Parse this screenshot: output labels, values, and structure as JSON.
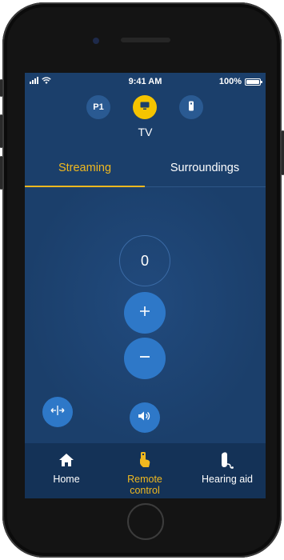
{
  "status_bar": {
    "time": "9:41 AM",
    "battery_percent": "100%"
  },
  "programs": [
    {
      "label": "P1",
      "active": false
    },
    {
      "icon": "tv-icon",
      "active": true
    },
    {
      "icon": "remote-icon",
      "active": false
    }
  ],
  "device_label": "TV",
  "tabs": [
    {
      "label": "Streaming",
      "active": true
    },
    {
      "label": "Surroundings",
      "active": false
    }
  ],
  "volume": {
    "level": "0"
  },
  "bottom_nav": {
    "home": "Home",
    "remote_line1": "Remote",
    "remote_line2": "control",
    "hearing_aid": "Hearing aid"
  },
  "colors": {
    "background": "#1b3f6b",
    "accent": "#f0b81f",
    "button": "#2e78c8",
    "nav_bg": "#143257"
  }
}
